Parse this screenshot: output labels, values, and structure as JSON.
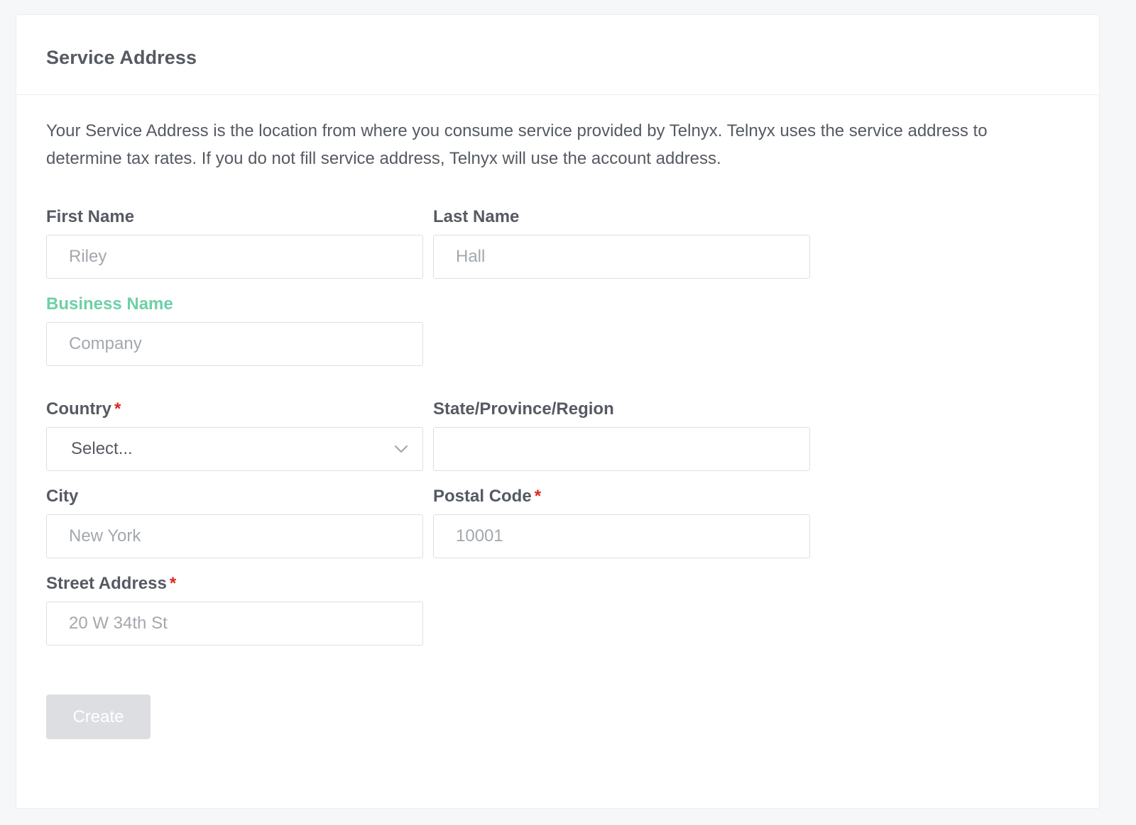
{
  "header": {
    "title": "Service Address"
  },
  "description": "Your Service Address is the location from where you consume service provided by Telnyx. Telnyx uses the service address to determine tax rates. If you do not fill service address, Telnyx will use the account address.",
  "fields": {
    "first_name": {
      "label": "First Name",
      "placeholder": "Riley",
      "value": ""
    },
    "last_name": {
      "label": "Last Name",
      "placeholder": "Hall",
      "value": ""
    },
    "business_name": {
      "label": "Business Name",
      "placeholder": "Company",
      "value": "",
      "focused": true
    },
    "country": {
      "label": "Country",
      "required_mark": "*",
      "selected": "Select..."
    },
    "state": {
      "label": "State/Province/Region",
      "placeholder": "",
      "value": ""
    },
    "city": {
      "label": "City",
      "placeholder": "New York",
      "value": ""
    },
    "postal_code": {
      "label": "Postal Code",
      "required_mark": "*",
      "placeholder": "10001",
      "value": ""
    },
    "street_address": {
      "label": "Street Address",
      "required_mark": "*",
      "placeholder": "20 W 34th St",
      "value": ""
    }
  },
  "actions": {
    "create_label": "Create",
    "create_disabled": true
  },
  "icons": {
    "country_dropdown": "chevron-down-icon"
  },
  "colors": {
    "focused_label": "#6fcfa8",
    "required_mark": "#e0241e",
    "disabled_button_bg": "#dcdee1",
    "text": "#555a62",
    "placeholder": "#a3a8ae"
  }
}
